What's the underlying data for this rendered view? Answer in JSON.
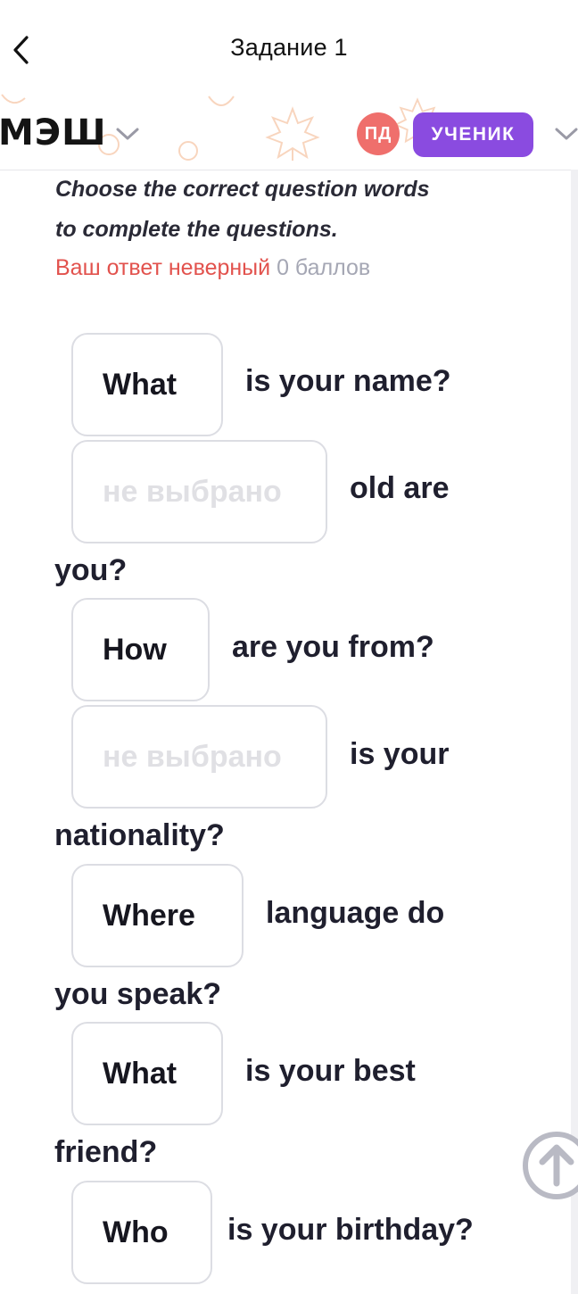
{
  "topbar": {
    "title": "Задание 1",
    "back_icon": "chevron-left-icon"
  },
  "app_header": {
    "logo": "МЭШ",
    "avatar_initials": "ПД",
    "role_label": "УЧЕНИК",
    "colors": {
      "avatar_bg": "#ef6f6c",
      "role_bg": "#8a4be0",
      "decoration": "#f4b48a"
    }
  },
  "task": {
    "instruction_line1": "Choose the correct question words",
    "instruction_line2": "to complete the questions.",
    "result_status": "Ваш ответ неверный",
    "result_score": "0 баллов"
  },
  "questions": [
    {
      "answer": "What",
      "text": "is your name?",
      "continuation": ""
    },
    {
      "answer": "не выбрано",
      "text": "old are",
      "continuation": "you?",
      "empty": true
    },
    {
      "answer": "How",
      "text": "are you from?",
      "continuation": ""
    },
    {
      "answer": "не выбрано",
      "text": "is your",
      "continuation": "nationality?",
      "empty": true
    },
    {
      "answer": "Where",
      "text": "language do",
      "continuation": "you speak?"
    },
    {
      "answer": "What",
      "text": "is your best",
      "continuation": "friend?"
    },
    {
      "answer": "Who",
      "text": "is your birthday?",
      "continuation": ""
    }
  ],
  "scroll_top_icon": "arrow-up-circle-icon"
}
